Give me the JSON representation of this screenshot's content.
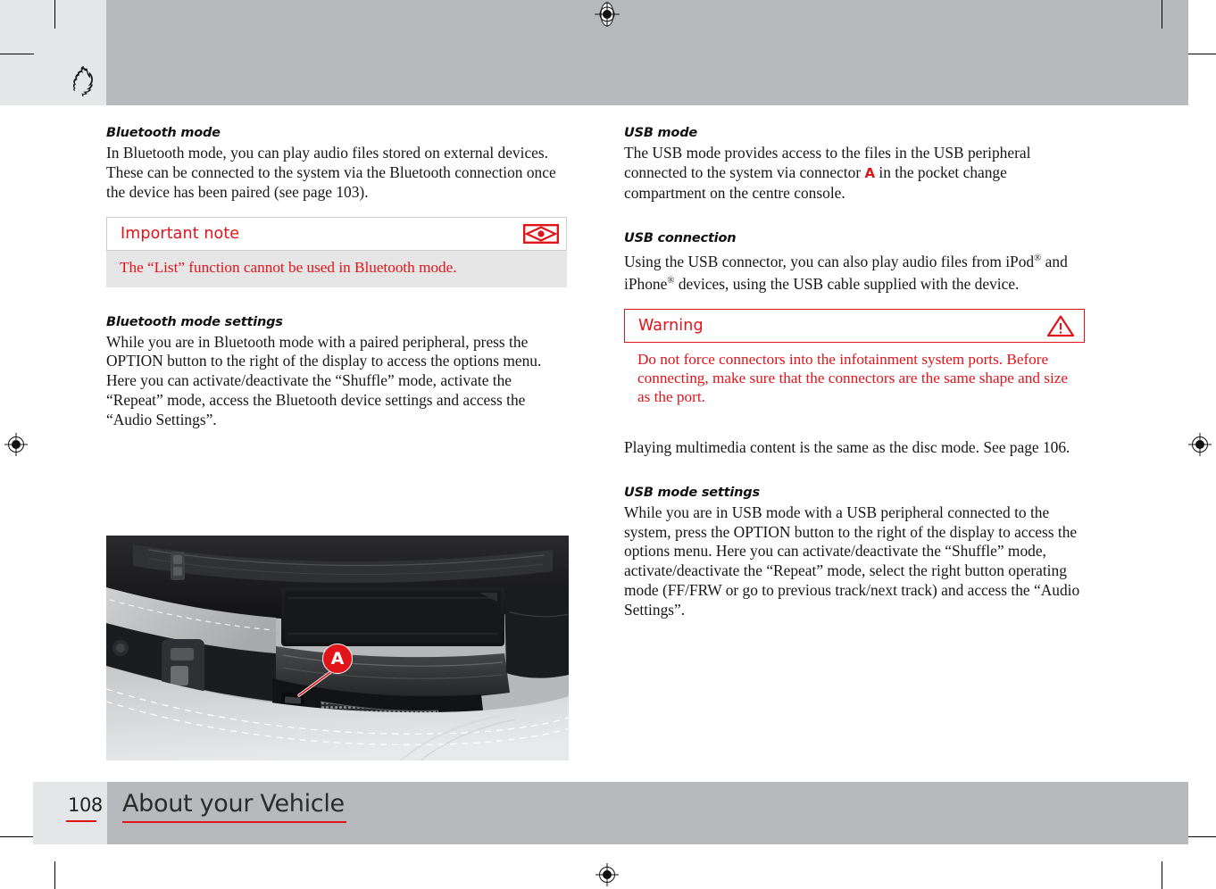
{
  "document": {
    "page_number": "108",
    "footer_title": "About your Vehicle",
    "brand_logo": "ferrari-prancing-horse"
  },
  "colors": {
    "accent_red": "#e1141a",
    "header_band": "#b7b9bc",
    "margin_band": "#e5e6e8",
    "note_body_bg": "#e6e6e6"
  },
  "left_column": {
    "section1": {
      "heading": "Bluetooth mode",
      "body": "In Bluetooth mode, you can play audio files stored on external devices. These can be connected to the system via the Bluetooth connection once the device has been paired (see page 103)."
    },
    "note_box": {
      "title": "Important note",
      "icon": "eye-in-diamond-icon",
      "body": "The “List” function cannot be used in Bluetooth mode."
    },
    "section2": {
      "heading": "Bluetooth mode settings",
      "body": "While you are in Bluetooth mode with a paired peripheral, press the OPTION button to the right of the display to access the options menu. Here you can activate/deactivate the “Shuffle” mode, activate the “Repeat” mode, access the Bluetooth device settings and access the “Audio Settings”."
    },
    "figure": {
      "caption_label": "A",
      "description": "Photograph of the centre console pocket change compartment showing the USB connector"
    }
  },
  "right_column": {
    "section1": {
      "heading": "USB mode",
      "body_part1": "The USB mode provides access to the files in the USB peripheral connected to the system via connector ",
      "body_ref": "A",
      "body_part2": " in the pocket change compartment on the centre console."
    },
    "section2": {
      "heading": "USB connection",
      "body_part1": "Using the USB connector, you can also play audio files from iPod",
      "sup1": "®",
      "body_part2": " and iPhone",
      "sup2": "®",
      "body_part3": " devices, using the USB cable supplied with the device."
    },
    "warning_box": {
      "title": "Warning",
      "icon": "warning-triangle-icon",
      "body": "Do not force connectors into the infotainment system ports. Before connecting, make sure that the connectors are the same shape and size as the port."
    },
    "section3": {
      "body": "Playing multimedia content is the same as the disc mode. See page 106."
    },
    "section4": {
      "heading": "USB mode settings",
      "body": "While you are in USB mode with a USB peripheral connected to the system, press the OPTION button to the right of the display to access the options menu. Here you can activate/deactivate the “Shuffle” mode, activate/deactivate the “Repeat” mode, select the right button operating mode (FF/FRW or go to previous track/next track) and access the “Audio Settings”."
    }
  }
}
